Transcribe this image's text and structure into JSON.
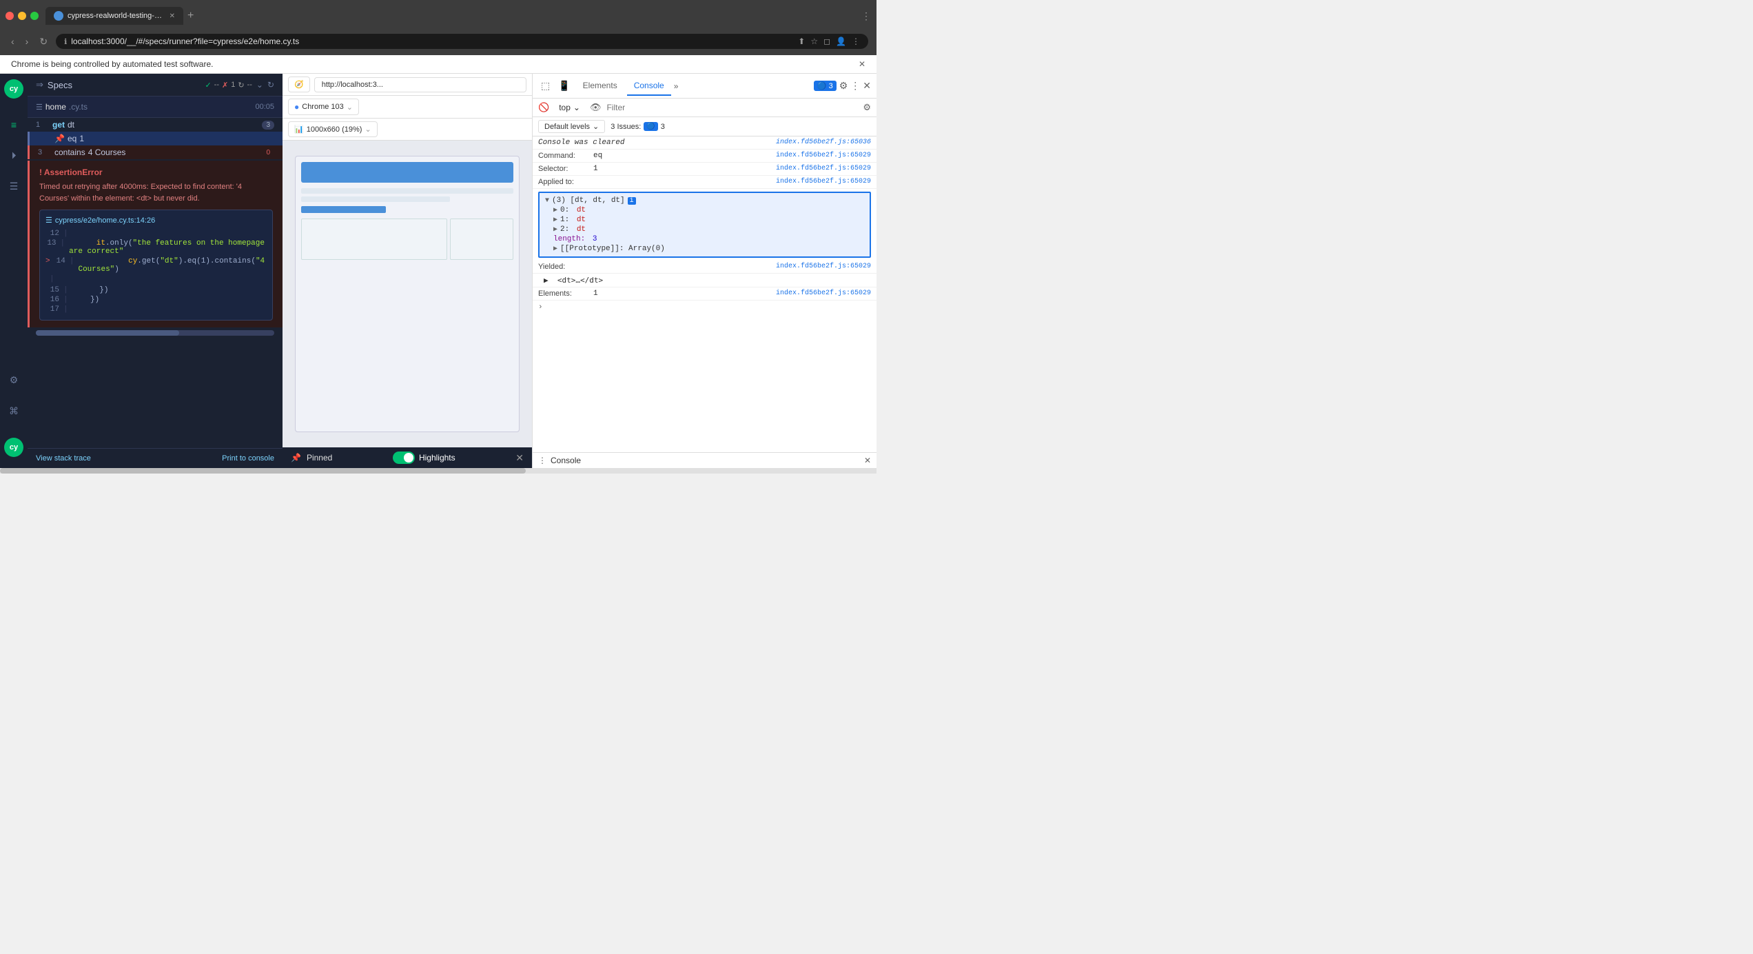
{
  "browser": {
    "tab_title": "cypress-realworld-testing-cou",
    "url": "localhost:3000/__/#/specs/runner?file=cypress/e2e/home.cy.ts",
    "notification": "Chrome is being controlled by automated test software."
  },
  "cypress": {
    "specs_label": "Specs",
    "spec_file": "home",
    "spec_ext": ".cy.ts",
    "spec_time": "00:05",
    "status": {
      "check": "✓",
      "dash": "--",
      "cross": "✗",
      "count": "1",
      "spinner": "↻",
      "dash2": "--"
    }
  },
  "commands": [
    {
      "num": "1",
      "type": "get",
      "arg": "dt",
      "badge": "3"
    },
    {
      "num": "",
      "type": "eq",
      "arg": "1",
      "badge": "",
      "pinned": true
    },
    {
      "num": "3",
      "type": "contains",
      "arg": "4 Courses",
      "badge": "0"
    }
  ],
  "error": {
    "title": "AssertionError",
    "message": "Timed out retrying after 4000ms: Expected to find content: '4 Courses' within the element: <dt> but never did.",
    "file_link": "cypress/e2e/home.cy.ts:14:26",
    "code_lines": [
      {
        "num": "12",
        "content": "|"
      },
      {
        "num": "13",
        "content": "|      it.only(\"the features on the homepage are correct\""
      },
      {
        "num": "14",
        "content": "|           cy.get(\"dt\").eq(1).contains(\"4 Courses\")",
        "current": true
      },
      {
        "num": "",
        "content": "|",
        "caret": true
      },
      {
        "num": "15",
        "content": "|     })"
      },
      {
        "num": "16",
        "content": "|   })"
      },
      {
        "num": "17",
        "content": "|"
      }
    ],
    "view_stack_trace": "View stack trace",
    "print_console": "Print to console"
  },
  "preview": {
    "url": "http://localhost:3...",
    "browser": "Chrome 103",
    "size": "1000x660 (19%)",
    "pinned_label": "Pinned",
    "highlights_label": "Highlights"
  },
  "devtools": {
    "tabs": [
      "Elements",
      "Console",
      "»"
    ],
    "active_tab": "Console",
    "badge_count": "3",
    "filter_placeholder": "Filter",
    "context": "top",
    "default_levels": "Default levels",
    "issues_label": "3 Issues:",
    "issues_count": "3",
    "console_log": {
      "cleared": "Console was cleared",
      "cleared_link": "index.fd56be2f.js:65036",
      "command_label": "Command:",
      "command_val": "eq",
      "command_link": "index.fd56be2f.js:65029",
      "selector_label": "Selector:",
      "selector_val": "1",
      "selector_link": "index.fd56be2f.js:65029",
      "applied_label": "Applied to:",
      "applied_link": "index.fd56be2f.js:65029",
      "tree_root": "(3) [dt, dt, dt]",
      "tree_0": "▶ 0: dt",
      "tree_1": "▶ 1: dt",
      "tree_2": "▶ 2: dt",
      "tree_length": "length: 3",
      "tree_proto": "▶ [[Prototype]]: Array(0)",
      "yielded_label": "Yielded:",
      "yielded_link": "index.fd56be2f.js:65029",
      "yielded_val": "▶ <dt>…</dt>",
      "elements_label": "Elements:",
      "elements_val": "1",
      "elements_link": "index.fd56be2f.js:65029"
    },
    "footer_label": "Console"
  }
}
